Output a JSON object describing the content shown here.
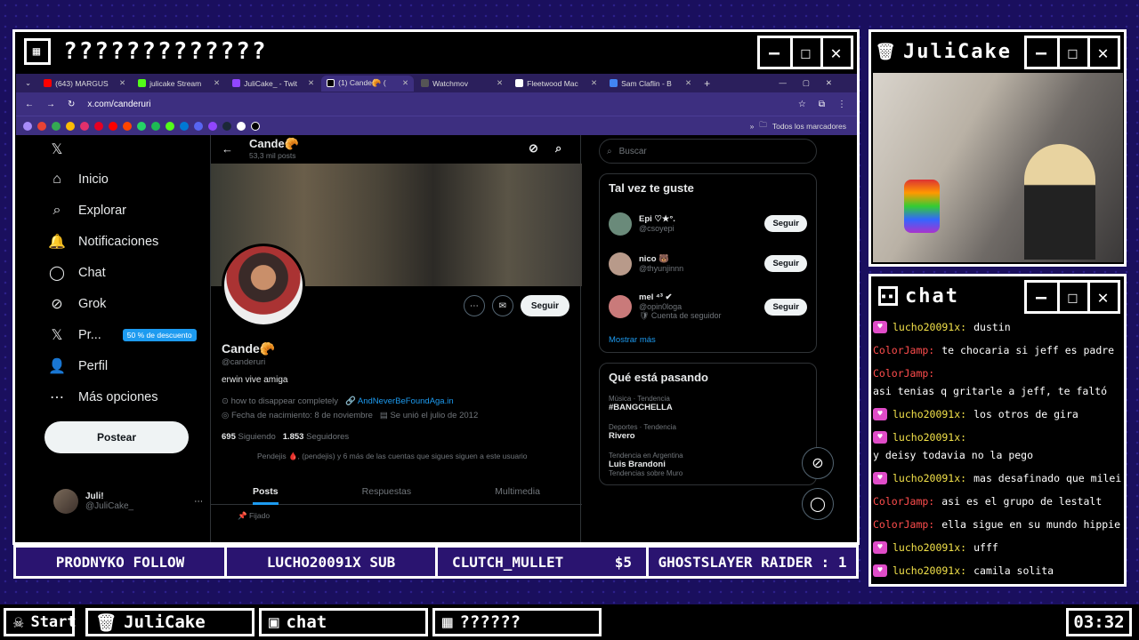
{
  "main_window": {
    "title": "?????????????"
  },
  "cam_window": {
    "title": "JuliCake"
  },
  "chat_window": {
    "title": "chat"
  },
  "browser": {
    "tabs": [
      {
        "label": "(643) MARGUS",
        "color": "#ff0000"
      },
      {
        "label": "julicake Stream",
        "color": "#53fc18"
      },
      {
        "label": "JuliCake_ - Twit",
        "color": "#9146ff"
      },
      {
        "label": "(1) Cande🥐 (",
        "color": "#000000"
      },
      {
        "label": "Watchmov",
        "color": "#555555"
      },
      {
        "label": "Fleetwood Mac",
        "color": "#ffffff"
      },
      {
        "label": "Sam Claflin - B",
        "color": "#4285f4"
      }
    ],
    "url": "x.com/canderuri",
    "bookmarks_label": "Todos los marcadores"
  },
  "x": {
    "nav": [
      {
        "icon": "𝕏",
        "label": ""
      },
      {
        "icon": "⌂",
        "label": "Inicio"
      },
      {
        "icon": "⌕",
        "label": "Explorar"
      },
      {
        "icon": "🔔",
        "label": "Notificaciones"
      },
      {
        "icon": "◯",
        "label": "Chat"
      },
      {
        "icon": "⊘",
        "label": "Grok"
      },
      {
        "icon": "𝕏",
        "label": "Pr..."
      },
      {
        "icon": "👤",
        "label": "Perfil"
      },
      {
        "icon": "⋯",
        "label": "Más opciones"
      }
    ],
    "promo": "50 % de descuento",
    "post_button": "Postear",
    "me": {
      "name": "Juli!",
      "handle": "@JuliCake_"
    },
    "header": {
      "name": "Cande🥐",
      "posts": "53,3 mil posts"
    },
    "profile": {
      "name": "Cande🥐",
      "handle": "@canderuri",
      "bio": "erwin vive amiga",
      "song": "how to disappear completely",
      "link": "AndNeverBeFoundAga.in",
      "birth": "Fecha de nacimiento: 8 de noviembre",
      "joined": "Se unió el julio de 2012",
      "following_num": "695",
      "following_label": "Siguiendo",
      "followers_num": "1.853",
      "followers_label": "Seguidores",
      "mutuals": "Pendejis 🩸, (pendejis) y 6 más de las cuentas que sigues siguen a este usuario",
      "follow_btn": "Seguir"
    },
    "tabs": [
      "Posts",
      "Respuestas",
      "Multimedia"
    ],
    "pinned": "Fijado",
    "search_placeholder": "Buscar",
    "suggest_title": "Tal vez te guste",
    "suggestions": [
      {
        "name": "Epi ♡★°.",
        "handle": "@csoyepi",
        "extra": "",
        "btn": "Seguir"
      },
      {
        "name": "nico 🐻",
        "handle": "@thyunjinnn",
        "extra": "",
        "btn": "Seguir"
      },
      {
        "name": "mel ⁴³ ✔",
        "handle": "@opin0loga",
        "extra": "🛡 Cuenta de seguidor",
        "btn": "Seguir"
      }
    ],
    "show_more": "Mostrar más",
    "trends_title": "Qué está pasando",
    "trends": [
      {
        "cat": "Música · Tendencia",
        "title": "#BANGCHELLA",
        "sub": ""
      },
      {
        "cat": "Deportes · Tendencia",
        "title": "Rivero",
        "sub": ""
      },
      {
        "cat": "Tendencia en Argentina",
        "title": "Luis Brandoni",
        "sub": "Tendencias sobre Muro"
      }
    ]
  },
  "chat": [
    {
      "user": "lucho20091x:",
      "text": "dustin",
      "color": "#f3e24a",
      "heart": true
    },
    {
      "user": "ColorJamp:",
      "text": "te chocaria si jeff es padre",
      "color": "#ff4d4d",
      "heart": false
    },
    {
      "user": "ColorJamp:",
      "text": "asi tenias q gritarle a jeff, te faltó",
      "color": "#ff4d4d",
      "heart": false
    },
    {
      "user": "lucho20091x:",
      "text": "los otros de gira",
      "color": "#f3e24a",
      "heart": true
    },
    {
      "user": "lucho20091x:",
      "text": "y deisy todavia no la pego",
      "color": "#f3e24a",
      "heart": true
    },
    {
      "user": "lucho20091x:",
      "text": "mas desafinado que milei",
      "color": "#f3e24a",
      "heart": true
    },
    {
      "user": "ColorJamp:",
      "text": "asi es el grupo de lestalt",
      "color": "#ff4d4d",
      "heart": false
    },
    {
      "user": "ColorJamp:",
      "text": "ella sigue en su mundo hippie",
      "color": "#ff4d4d",
      "heart": false
    },
    {
      "user": "lucho20091x:",
      "text": "ufff",
      "color": "#f3e24a",
      "heart": true
    },
    {
      "user": "lucho20091x:",
      "text": "camila solita",
      "color": "#f3e24a",
      "heart": true
    }
  ],
  "ticker": [
    "PRODNYKO FOLLOW",
    "LUCHO20091X SUB",
    "CLUTCH_MULLET",
    "$5",
    "GHOSTSLAYER RAIDER : 1"
  ],
  "taskbar": {
    "start": "Start",
    "items": [
      "JuliCake",
      "chat",
      "??????"
    ],
    "clock": "03:32"
  }
}
